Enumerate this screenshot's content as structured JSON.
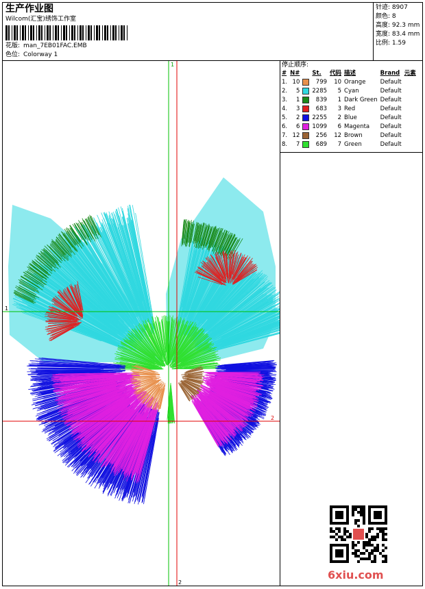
{
  "header": {
    "title": "生产作业图",
    "company": "Wilcom(汇宝)绣饰工作室",
    "design_label": "花版:",
    "design_value": "man_7EB01FAC.EMB",
    "colorway_label": "色位:",
    "colorway_value": "Colorway 1"
  },
  "stats": [
    {
      "label": "针迹:",
      "value": "8907"
    },
    {
      "label": "颜色:",
      "value": "8"
    },
    {
      "label": "高度:",
      "value": "92.3 mm"
    },
    {
      "label": "宽度:",
      "value": "83.4 mm"
    },
    {
      "label": "比例:",
      "value": "1.59"
    }
  ],
  "stop_sequence": {
    "title": "停止顺序:",
    "columns": [
      "#",
      "N#",
      "St.",
      "代码",
      "描述",
      "Brand",
      "元素"
    ],
    "rows": [
      {
        "idx": "1.",
        "n": "10",
        "color": "#e8904c",
        "st": "799",
        "code": "10",
        "desc": "Orange",
        "brand": "Default"
      },
      {
        "idx": "2.",
        "n": "5",
        "color": "#30d8e0",
        "st": "2285",
        "code": "5",
        "desc": "Cyan",
        "brand": "Default"
      },
      {
        "idx": "3.",
        "n": "1",
        "color": "#1a8a1a",
        "st": "839",
        "code": "1",
        "desc": "Dark Green",
        "brand": "Default"
      },
      {
        "idx": "4.",
        "n": "3",
        "color": "#e02020",
        "st": "683",
        "code": "3",
        "desc": "Red",
        "brand": "Default"
      },
      {
        "idx": "5.",
        "n": "2",
        "color": "#1010e0",
        "st": "2255",
        "code": "2",
        "desc": "Blue",
        "brand": "Default"
      },
      {
        "idx": "6.",
        "n": "6",
        "color": "#e020e0",
        "st": "1099",
        "code": "6",
        "desc": "Magenta",
        "brand": "Default"
      },
      {
        "idx": "7.",
        "n": "12",
        "color": "#9a6434",
        "st": "256",
        "code": "12",
        "desc": "Brown",
        "brand": "Default"
      },
      {
        "idx": "8.",
        "n": "7",
        "color": "#30e030",
        "st": "689",
        "code": "7",
        "desc": "Green",
        "brand": "Default"
      }
    ]
  },
  "axes": {
    "v_top": "1",
    "v_bottom": "2",
    "h_left": "1",
    "h_right": "2"
  },
  "watermark": "6xiu.com"
}
